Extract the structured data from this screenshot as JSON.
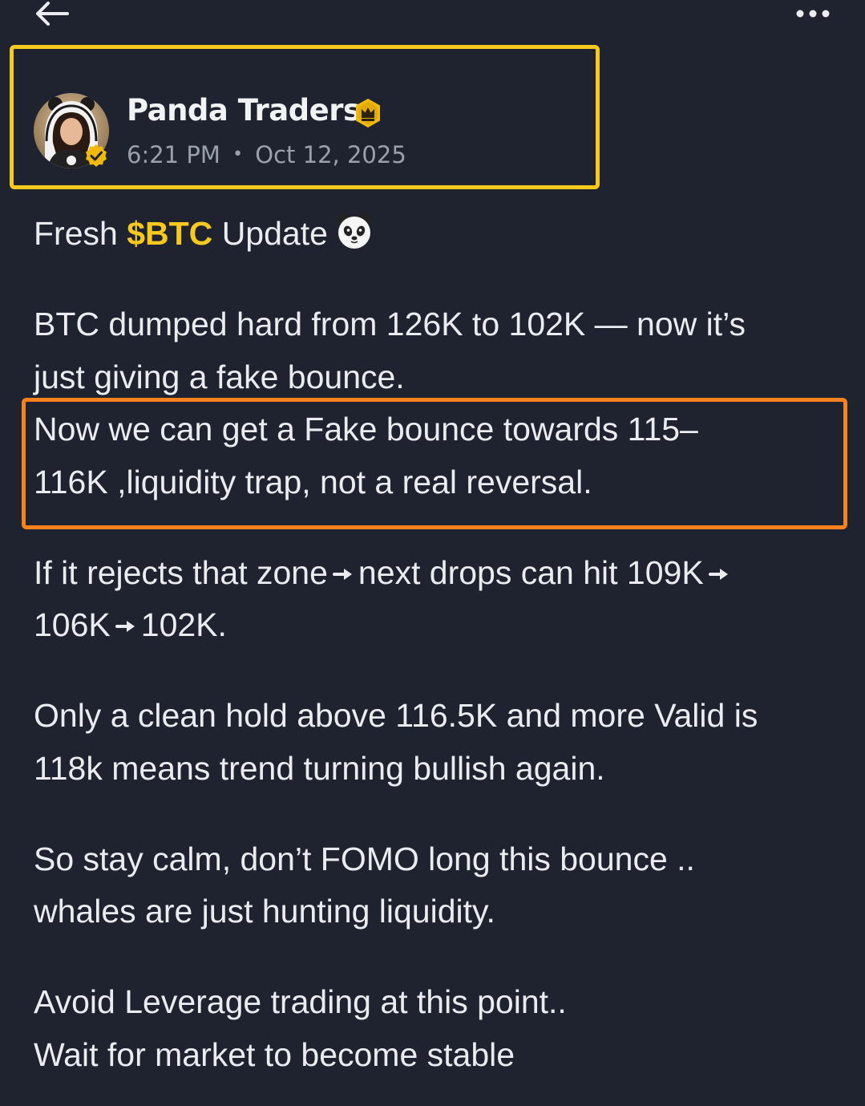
{
  "header": {
    "back_icon": "arrow-left-icon",
    "more_icon": "more-horizontal-icon"
  },
  "author": {
    "name": "Panda Traders",
    "badge_icon": "crown-icon",
    "verified_icon": "verified-check-icon",
    "time": "6:21 PM",
    "separator": "•",
    "date": "Oct 12, 2025"
  },
  "post": {
    "title_prefix": "Fresh",
    "cashtag": "$BTC",
    "title_suffix": "Update",
    "title_emoji": "panda-face-icon",
    "lines": {
      "l1": "BTC dumped hard from 126K to 102K — now it’s",
      "l2": "just giving a fake bounce.",
      "l3": "Now we can get a Fake bounce towards  115–",
      "l4": "116K ,liquidity trap, not a real reversal.",
      "l5a": "If it rejects that zone",
      "l5b": "next drops can hit 109K",
      "l6a": "106K",
      "l6b": "102K.",
      "l7": "Only a clean hold above 116.5K and more Valid is",
      "l8": "118k means trend turning bullish again.",
      "l9": "So stay calm, don’t FOMO long this bounce ..",
      "l10": "whales are just hunting liquidity.",
      "l11": "Avoid Leverage trading at this point..",
      "l12": "Wait for market to become stable"
    }
  },
  "colors": {
    "background": "#1f2330",
    "text": "#eaecef",
    "muted": "#9aa0ad",
    "accent_yellow": "#f7c81e",
    "highlight_orange": "#f5821f"
  }
}
